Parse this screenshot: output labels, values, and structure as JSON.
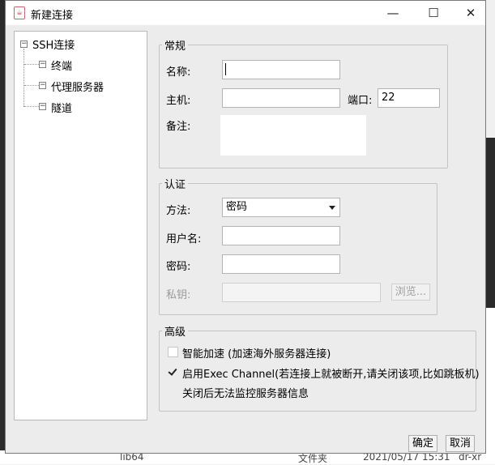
{
  "window": {
    "title": "新建连接",
    "controls": {
      "minimize": "—",
      "maximize": "☐",
      "close": "✕"
    }
  },
  "tree": {
    "root": "SSH连接",
    "children": [
      "终端",
      "代理服务器",
      "隧道"
    ]
  },
  "general": {
    "legend": "常规",
    "name_label": "名称:",
    "name_value": "",
    "host_label": "主机:",
    "host_value": "",
    "port_label": "端口:",
    "port_value": "22",
    "note_label": "备注:",
    "note_value": ""
  },
  "auth": {
    "legend": "认证",
    "method_label": "方法:",
    "method_value": "密码",
    "username_label": "用户名:",
    "username_value": "",
    "password_label": "密码:",
    "password_value": "",
    "key_label": "私钥:",
    "key_value": "",
    "browse_button": "浏览..."
  },
  "advanced": {
    "legend": "高级",
    "smart_accel_label": "智能加速 (加速海外服务器连接)",
    "smart_accel_checked": false,
    "exec_channel_label": "启用Exec Channel(若连接上就被断开,请关闭该项,比如跳板机)",
    "exec_channel_checked": true,
    "exec_channel_note": "关闭后无法监控服务器信息"
  },
  "footer": {
    "ok_button": "确定",
    "cancel_button": "取消"
  },
  "background": {
    "folder_name": "lib64",
    "type_text": "文件夹",
    "date_text": "2021/05/17 15:31",
    "perm_text": "dr-xr"
  }
}
